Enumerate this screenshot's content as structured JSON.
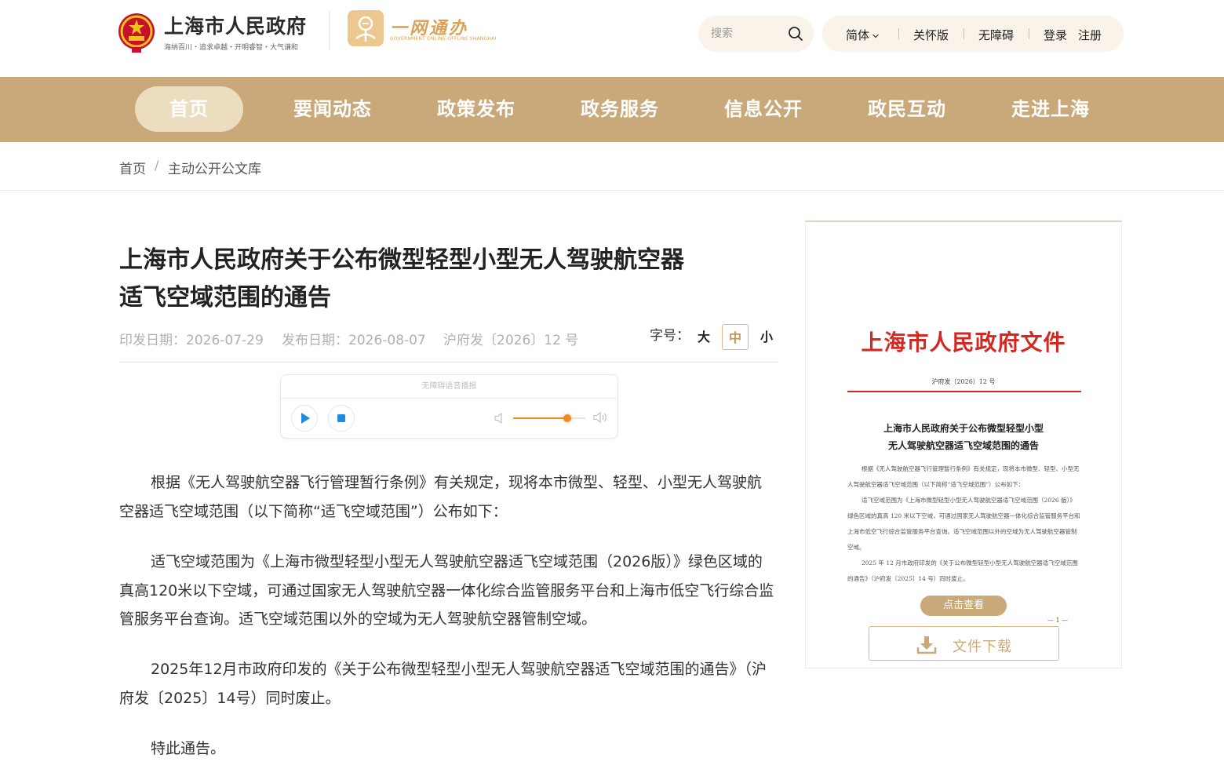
{
  "header": {
    "site_title": "上海市人民政府",
    "site_slogan": "海纳百川・追求卓越・开明睿智・大气谦和",
    "ywtb_title": "一网通办",
    "ywtb_sub": "GOVERNMENT ONLINE-OFFLINE SHANGHAI",
    "search_placeholder": "搜索",
    "lang_label": "简体",
    "care_label": "关怀版",
    "access_label": "无障碍",
    "login_label": "登录",
    "register_label": "注册"
  },
  "nav": {
    "items": [
      "首页",
      "要闻动态",
      "政策发布",
      "政务服务",
      "信息公开",
      "政民互动",
      "走进上海"
    ],
    "active_index": 0
  },
  "breadcrumb": {
    "home": "首页",
    "separator": "/",
    "current": "主动公开公文库"
  },
  "article": {
    "title_line1": "上海市人民政府关于公布微型轻型小型无人驾驶航空器",
    "title_line2": "适飞空域范围的通告",
    "print_date": "印发日期：2026-07-29",
    "publish_date": "发布日期：2026-08-07",
    "doc_no": "沪府发〔2026〕12 号",
    "font_size_label": "字号：",
    "font_sizes": [
      "大",
      "中",
      "小"
    ],
    "active_font_size": "中",
    "audio_title": "无障碍语音播报",
    "volume_level": 0.75,
    "paragraphs": [
      "根据《无人驾驶航空器飞行管理暂行条例》有关规定，现将本市微型、轻型、小型无人驾驶航空器适飞空域范围（以下简称“适飞空域范围”）公布如下：",
      "适飞空域范围为《上海市微型轻型小型无人驾驶航空器适飞空域范围（2026版）》绿色区域的真高120米以下空域，可通过国家无人驾驶航空器一体化综合监管服务平台和上海市低空飞行综合监管服务平台查询。适飞空域范围以外的空域为无人驾驶航空器管制空域。",
      "2025年12月市政府印发的《关于公布微型轻型小型无人驾驶航空器适飞空域范围的通告》（沪府发〔2025〕14号）同时废止。",
      "特此通告。"
    ]
  },
  "doc_preview": {
    "head": "上海市人民政府文件",
    "doc_no": "沪府发〔2026〕12 号",
    "title_line1": "上海市人民政府关于公布微型轻型小型",
    "title_line2": "无人驾驶航空器适飞空域范围的通告",
    "body": [
      "根据《无人驾驶航空器飞行管理暂行条例》有关规定，现将本市微型、轻型、小型无人驾驶航空器适飞空域范围（以下简称“适飞空域范围”）公布如下：",
      "适飞空域范围为《上海市微型轻型小型无人驾驶航空器适飞空域范围（2026 版）》绿色区域的真高 120 米以下空域，可通过国家无人驾驶航空器一体化综合监管服务平台和上海市低空飞行综合监管服务平台查询。适飞空域范围以外的空域为无人驾驶航空器管制空域。",
      "2025 年 12 月市政府印发的《关于公布微型轻型小型无人驾驶航空器适飞空域范围的通告》（沪府发〔2025〕14 号）同时废止。"
    ],
    "page_num": "— 1 —",
    "view_label": "点击查看",
    "download_label": "文件下载"
  },
  "colors": {
    "nav_bg": "#c9a97a",
    "nav_active_bg": "#ecdcc0",
    "header_pill_bg": "#faf3ea",
    "doc_red": "#d22a22",
    "accent_gold": "#c9a97a",
    "audio_accent": "#f08a24"
  },
  "icons": {
    "emblem": "national-emblem-icon",
    "ywtb_logo": "ywtb-logo-icon",
    "search": "search-icon",
    "chevron": "chevron-down-icon",
    "play": "play-icon",
    "stop": "stop-icon",
    "volume_low": "volume-low-icon",
    "volume_high": "volume-high-icon",
    "download": "download-icon"
  }
}
